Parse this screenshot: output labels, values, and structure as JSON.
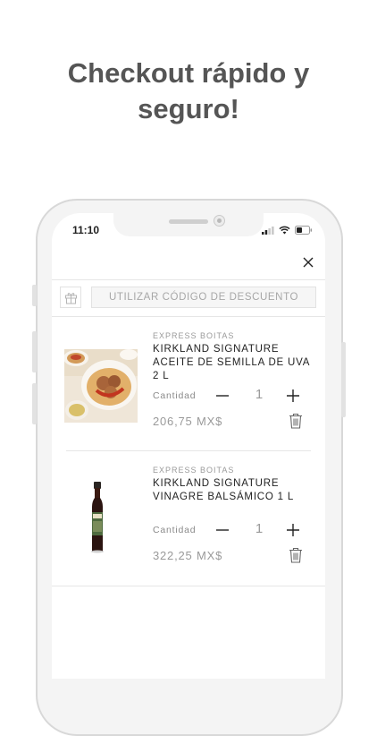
{
  "headline": {
    "line1": "Checkout rápido y",
    "line2": "seguro!"
  },
  "status_bar": {
    "time": "11:10"
  },
  "discount": {
    "label": "UTILIZAR CÓDIGO DE DESCUENTO"
  },
  "cart": {
    "items": [
      {
        "seller": "EXPRESS BOITAS",
        "title": "KIRKLAND SIGNATURE ACEITE DE SEMILLA DE UVA 2 L",
        "quantity_label": "Cantidad",
        "quantity": "1",
        "price": "206,75 MX$"
      },
      {
        "seller": "EXPRESS BOITAS",
        "title": "KIRKLAND SIGNATURE VINAGRE BALSÁMICO 1 L",
        "quantity_label": "Cantidad",
        "quantity": "1",
        "price": "322,25 MX$"
      }
    ]
  },
  "colors": {
    "headline": "#555555",
    "text": "#222222",
    "muted": "#9a9a9a",
    "frame": "#d8d8d8"
  }
}
